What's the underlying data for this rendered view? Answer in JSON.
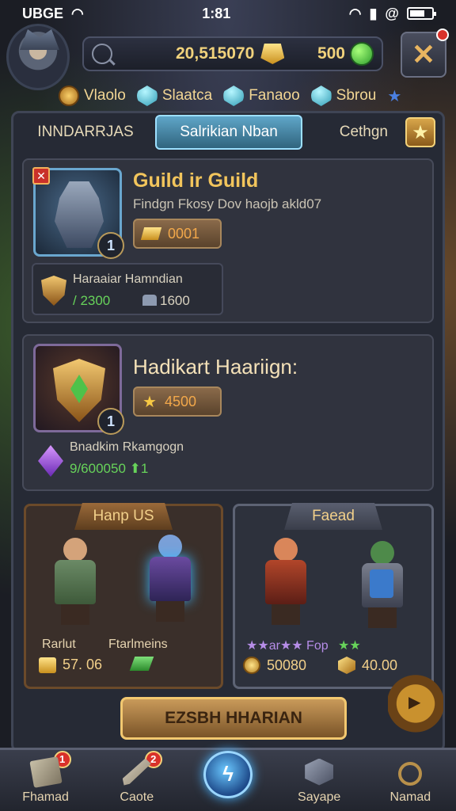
{
  "status_bar": {
    "carrier": "UBGE",
    "time": "1:81"
  },
  "header": {
    "gold": "20,515070",
    "gems": "500",
    "close_label": "✕"
  },
  "resource_tags": [
    {
      "label": "Vlaolo",
      "icon": "coin-icon"
    },
    {
      "label": "Slaatca",
      "icon": "crystal-icon"
    },
    {
      "label": "Fanaoo",
      "icon": "crystal-icon"
    },
    {
      "label": "Sbrou",
      "icon": "crystal-icon"
    }
  ],
  "tabs": [
    {
      "label": "INNDARRJAS",
      "active": false
    },
    {
      "label": "Salrikian Nban",
      "active": true
    },
    {
      "label": "Cethgn",
      "active": false
    }
  ],
  "guild_cards": [
    {
      "title": "Guild ir Guild",
      "subtitle": "Findgn Fkosy Dov haojb akld07",
      "price": "0001",
      "level": "1",
      "leader_name": "Haraaiar Hamndian",
      "power": "/ 2300",
      "members": "1600"
    },
    {
      "title": "Hadikart Haariign:",
      "price": "4500",
      "level": "1",
      "leader_name": "Bnadkim Rkamgogn",
      "power": "9/600050 ⬆1"
    }
  ],
  "hero_panels": [
    {
      "title": "Hanp US",
      "label_left": "Rarlut",
      "label_right": "Ftarlmeins",
      "price_left": "57. 06",
      "price_right": ""
    },
    {
      "title": "Faead",
      "label_left": "★★ar★★ Fop",
      "label_right": "★★",
      "price_left": "50080",
      "price_right": "40.00"
    }
  ],
  "main_button": "EZSBH HHARIAN",
  "bottom_nav": [
    {
      "label": "Fhamad",
      "badge": "1",
      "icon": "scroll-icon"
    },
    {
      "label": "Caote",
      "badge": "2",
      "icon": "sword-icon"
    },
    {
      "label": "",
      "badge": "",
      "icon": "lightning-orb-icon"
    },
    {
      "label": "Sayape",
      "badge": "",
      "icon": "cube-icon"
    },
    {
      "label": "Namad",
      "badge": "",
      "icon": "magnifier-icon"
    }
  ],
  "colors": {
    "accent_gold": "#f2c55c",
    "tab_active": "#5fa6c8",
    "power_green": "#67d35a",
    "notification_red": "#d9312a"
  }
}
